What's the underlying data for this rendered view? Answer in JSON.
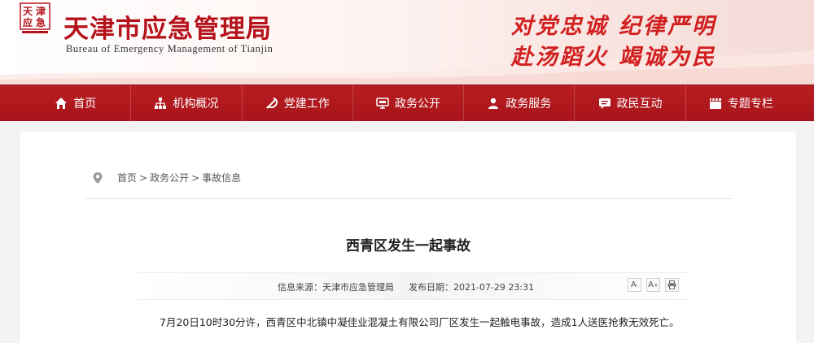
{
  "header": {
    "title": "天津市应急管理局",
    "title_en": "Bureau of Emergency Management of Tianjin",
    "slogan_line1": "对党忠诚  纪律严明",
    "slogan_line2": "赴汤蹈火  竭诚为民"
  },
  "nav": {
    "items": [
      {
        "label": "首页",
        "icon": "home-icon"
      },
      {
        "label": "机构概况",
        "icon": "org-chart-icon"
      },
      {
        "label": "党建工作",
        "icon": "party-emblem-icon"
      },
      {
        "label": "政务公开",
        "icon": "monitor-icon"
      },
      {
        "label": "政务服务",
        "icon": "user-service-icon"
      },
      {
        "label": "政民互动",
        "icon": "chat-icon"
      },
      {
        "label": "专题专栏",
        "icon": "clapperboard-icon"
      }
    ]
  },
  "breadcrumb": {
    "home": "首页",
    "level1": "政务公开",
    "level2": "事故信息",
    "separator": ">"
  },
  "article": {
    "title": "西青区发生一起事故",
    "source_label": "信息来源：",
    "source": "天津市应急管理局",
    "date_label": "发布日期：",
    "date": "2021-07-29 23:31",
    "body": "7月20日10时30分许，西青区中北镇中凝佳业混凝土有限公司厂区发生一起触电事故，造成1人送医抢救无效死亡。"
  },
  "tools": {
    "shrink_label": "A",
    "enlarge_label": "A",
    "print_icon": "print-icon"
  },
  "colors": {
    "brand_red": "#b5121b",
    "nav_red": "#a8141a"
  }
}
